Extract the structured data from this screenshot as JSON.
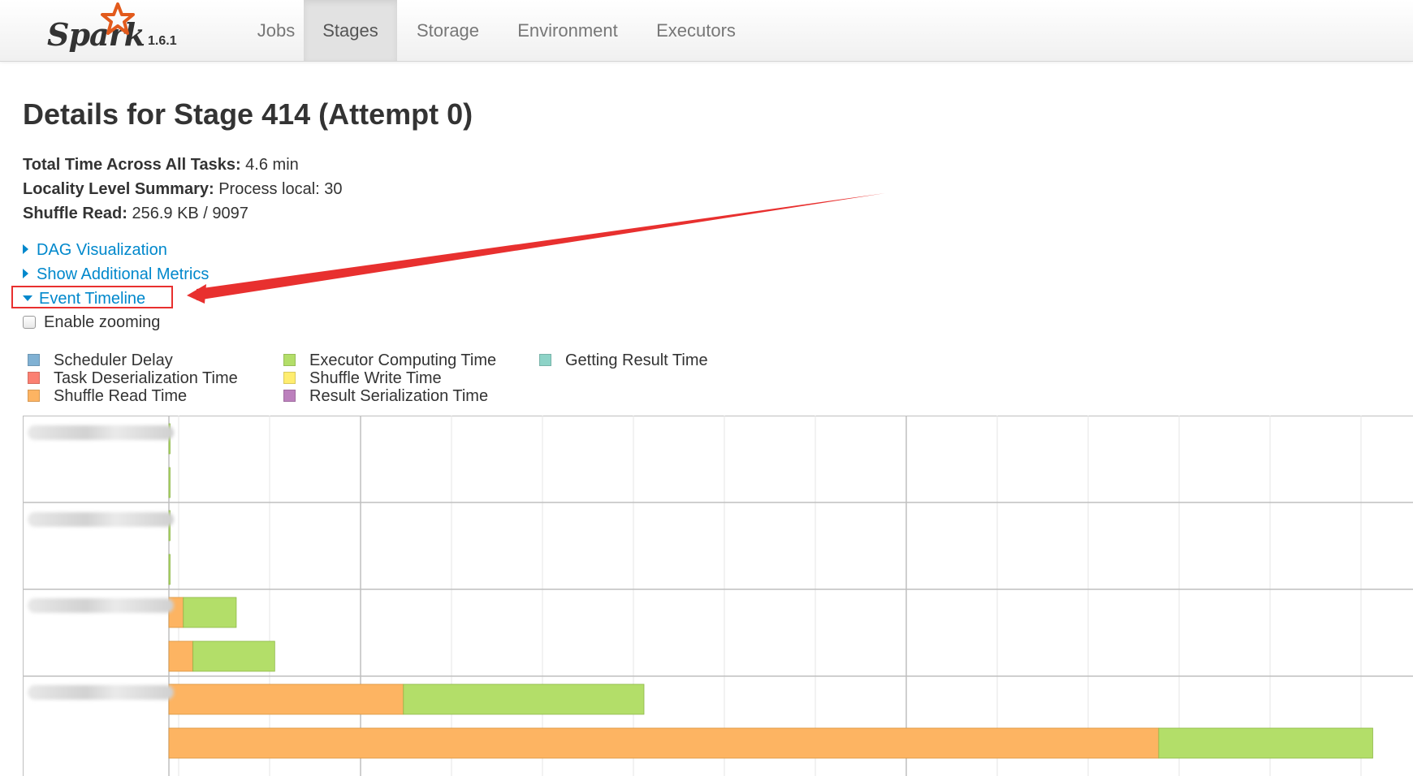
{
  "navbar": {
    "brand": "Spark",
    "version": "1.6.1",
    "tabs": [
      {
        "label": "Jobs",
        "active": false
      },
      {
        "label": "Stages",
        "active": true
      },
      {
        "label": "Storage",
        "active": false
      },
      {
        "label": "Environment",
        "active": false
      },
      {
        "label": "Executors",
        "active": false
      }
    ]
  },
  "page": {
    "title": "Details for Stage 414 (Attempt 0)"
  },
  "summary": {
    "total_time_label": "Total Time Across All Tasks:",
    "total_time_value": "4.6 min",
    "locality_label": "Locality Level Summary:",
    "locality_value": "Process local: 30",
    "shuffle_read_label": "Shuffle Read:",
    "shuffle_read_value": "256.9 KB / 9097"
  },
  "toggles": {
    "dag": "DAG Visualization",
    "additional_metrics": "Show Additional Metrics",
    "event_timeline": "Event Timeline"
  },
  "zoom": {
    "label": "Enable zooming",
    "checked": false
  },
  "legend": [
    {
      "label": "Scheduler Delay",
      "color": "#80b1d3"
    },
    {
      "label": "Task Deserialization Time",
      "color": "#fb8072"
    },
    {
      "label": "Shuffle Read Time",
      "color": "#fdb462"
    },
    {
      "label": "Executor Computing Time",
      "color": "#b3de69"
    },
    {
      "label": "Shuffle Write Time",
      "color": "#ffed6f"
    },
    {
      "label": "Result Serialization Time",
      "color": "#bc80bd"
    },
    {
      "label": "Getting Result Time",
      "color": "#8dd3c7"
    }
  ],
  "timeline": {
    "groups": [
      {
        "tasks": [
          {
            "shuffle_read": 0.0,
            "executor_computing": 0.001
          },
          {
            "shuffle_read": 0.0,
            "executor_computing": 0.001
          }
        ]
      },
      {
        "tasks": [
          {
            "shuffle_read": 0.0,
            "executor_computing": 0.001
          },
          {
            "shuffle_read": 0.0,
            "executor_computing": 0.001
          }
        ]
      },
      {
        "tasks": [
          {
            "shuffle_read": 0.012,
            "executor_computing": 0.044
          },
          {
            "shuffle_read": 0.02,
            "executor_computing": 0.068
          }
        ]
      },
      {
        "tasks": [
          {
            "shuffle_read": 0.195,
            "executor_computing": 0.2
          },
          {
            "shuffle_read": 0.823,
            "executor_computing": 0.178
          }
        ]
      }
    ]
  },
  "colors": {
    "link": "#0088cc",
    "annotation": "#e8302f"
  }
}
